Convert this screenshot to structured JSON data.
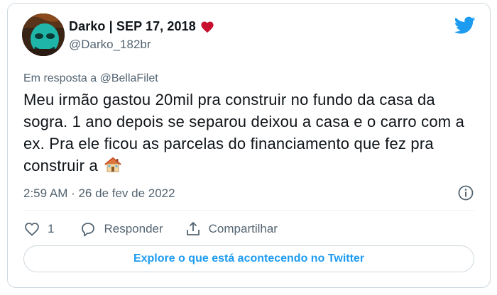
{
  "author": {
    "name": "Darko | SEP 17, 2018",
    "handle": "@Darko_182br"
  },
  "reply_to": {
    "prefix": "Em resposta a ",
    "mention": "@BellaFilet"
  },
  "tweet": {
    "text": "Meu irmão gastou 20mil pra construir no fundo da casa da sogra. 1 ano depois se separou deixou a casa e o carro com a ex. Pra ele ficou as parcelas do financiamento que fez pra construir a",
    "timestamp": "2:59 AM · 26 de fev de 2022"
  },
  "actions": {
    "like_count": "1",
    "reply_label": "Responder",
    "share_label": "Compartilhar"
  },
  "explore_label": "Explore o que está acontecendo no Twitter",
  "colors": {
    "twitter_blue": "#1d9bf0",
    "heart_red": "#c8102e",
    "muted_text": "#536471",
    "border": "#cfd9de"
  },
  "icons": [
    "twitter-bird-icon",
    "heart-icon",
    "house-icon",
    "info-icon",
    "like-icon",
    "reply-icon",
    "share-icon"
  ]
}
